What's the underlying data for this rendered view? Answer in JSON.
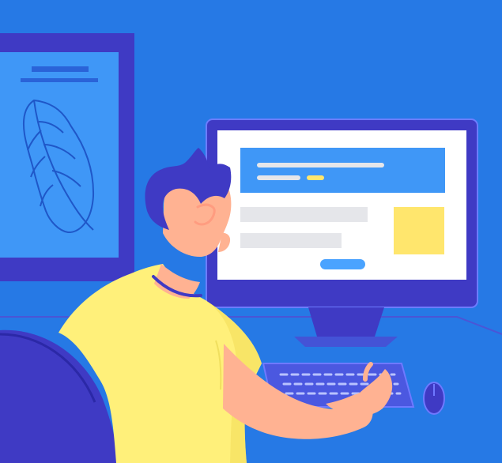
{
  "colors": {
    "background": "#2679e5",
    "wall_panel": "#3a8cf6",
    "dark_blue": "#3f3ac4",
    "monitor_screen": "#ffffff",
    "screen_header": "#3f97f7",
    "placeholder_gray": "#e5e6ea",
    "highlight_yellow": "#ffe66d",
    "pill_blue": "#4aa3ff",
    "shirt_yellow": "#fff07a",
    "skin": "#ffb292"
  },
  "icons": {
    "picture": "leaf-drawing",
    "device": "desktop-monitor",
    "input": "keyboard",
    "pointer": "mouse"
  }
}
